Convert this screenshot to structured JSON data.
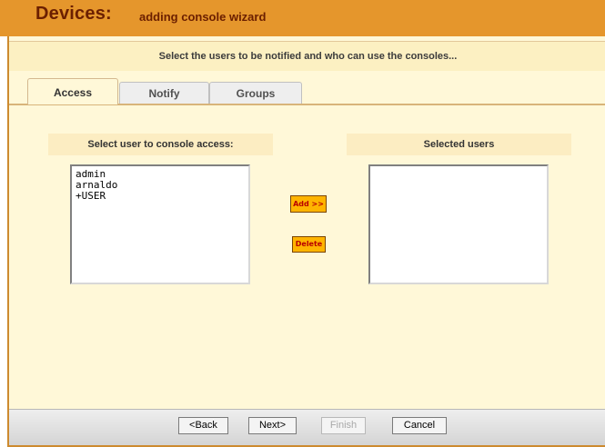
{
  "header": {
    "title": "Devices:",
    "subtitle": "adding console wizard"
  },
  "instruction": "Select the users to be notified and who can use the consoles...",
  "tabs": [
    {
      "label": "Access",
      "active": true
    },
    {
      "label": "Notify",
      "active": false
    },
    {
      "label": "Groups",
      "active": false
    }
  ],
  "available": {
    "heading": "Select user to console access:",
    "users": [
      "admin",
      "arnaldo",
      "+USER"
    ]
  },
  "selected": {
    "heading": "Selected users",
    "users": []
  },
  "actions": {
    "add_label": "Add >>",
    "delete_label": "Delete"
  },
  "footer": {
    "back_label": "<Back",
    "next_label": "Next>",
    "finish_label": "Finish",
    "cancel_label": "Cancel"
  },
  "colors": {
    "header_bg": "#e5962c",
    "header_text": "#6b1f00",
    "panel_bg": "#fff8d8",
    "action_button": "#ffb400"
  }
}
